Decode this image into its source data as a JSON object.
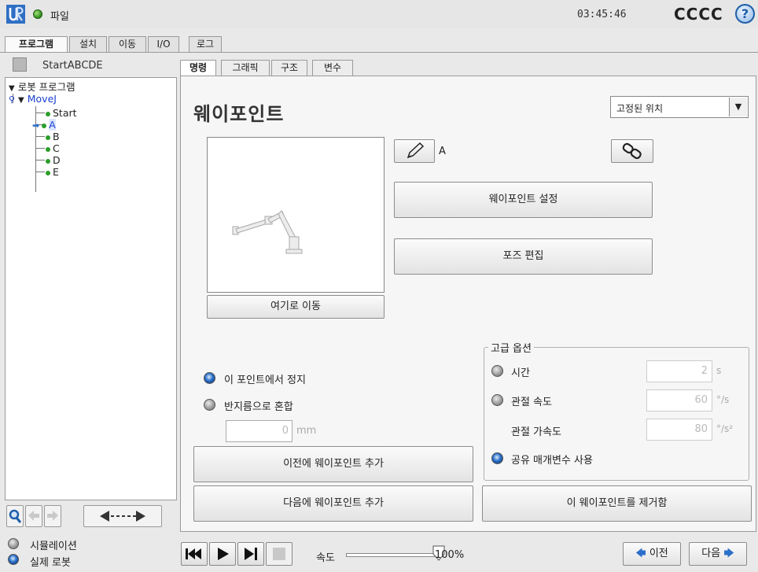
{
  "topbar": {
    "file_label": "파일",
    "clock": "03:45:46",
    "robot_name": "CCCC",
    "help_glyph": "?"
  },
  "main_tabs": [
    {
      "label": "프로그램",
      "active": true
    },
    {
      "label": "설치"
    },
    {
      "label": "이동"
    },
    {
      "label": "I/O"
    },
    {
      "label": "로그"
    }
  ],
  "program": {
    "name": "StartABCDE",
    "tree": {
      "root": "로봇 프로그램",
      "move": "MoveJ",
      "items": [
        "Start",
        "A",
        "B",
        "C",
        "D",
        "E"
      ],
      "selected": "A"
    }
  },
  "sub_tabs": [
    {
      "label": "명령",
      "active": true
    },
    {
      "label": "그래픽"
    },
    {
      "label": "구조"
    },
    {
      "label": "변수"
    }
  ],
  "waypoint": {
    "title": "웨이포인트",
    "position_type": "고정된 위치",
    "name": "A",
    "move_here": "여기로 이동",
    "set_waypoint": "웨이포인트 설정",
    "edit_pose": "포즈 편집",
    "stop_here": "이 포인트에서 정지",
    "blend_radius": "반지름으로 혼합",
    "blend_value": "0",
    "blend_unit": "mm",
    "add_before": "이전에 웨이포인트 추가",
    "add_after": "다음에 웨이포인트 추가",
    "remove": "이 웨이포인트를 제거함"
  },
  "advanced": {
    "title": "고급 옵션",
    "time_label": "시간",
    "time_value": "2",
    "time_unit": "s",
    "joint_speed_label": "관절 속도",
    "joint_speed_value": "60",
    "joint_speed_unit": "°/s",
    "joint_accel_label": "관절 가속도",
    "joint_accel_value": "80",
    "joint_accel_unit": "°/s²",
    "shared_label": "공유 매개변수 사용"
  },
  "bottombar": {
    "simulation": "시뮬레이션",
    "real_robot": "실제 로봇",
    "speed_label": "속도",
    "speed_value": "100%",
    "speed_fraction": 1.0,
    "prev": "이전",
    "next": "다음"
  },
  "colors": {
    "accent_blue": "#2a6fc9",
    "tree_blue": "#1a3fd0",
    "green": "#2a9d2a"
  }
}
